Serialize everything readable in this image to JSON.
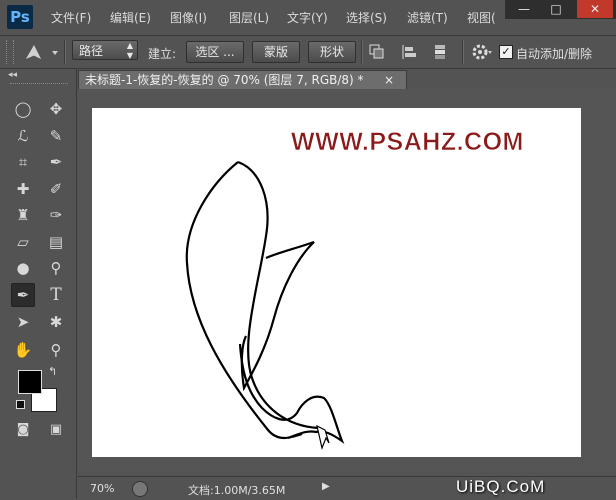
{
  "app": {
    "logo": "Ps"
  },
  "menu": [
    "文件(F)",
    "编辑(E)",
    "图像(I)",
    "图层(L)",
    "文字(Y)",
    "选择(S)",
    "滤镜(T)",
    "视图("
  ],
  "window_controls": {
    "minimize": "—",
    "restore": "□",
    "close": "✕"
  },
  "options_bar": {
    "mode_select": "路径",
    "make_label": "建立:",
    "selection_button": "选区 ...",
    "mask_button": "蒙版",
    "shape_button": "形状",
    "auto_add_delete_label": "自动添加/删除",
    "auto_add_delete_checked": true
  },
  "document": {
    "tab_title": "未标题-1-恢复的-恢复的 @ 70% (图层 7, RGB/8) *",
    "close": "×",
    "watermark_text": "WWW.PSAHZ.COM"
  },
  "status": {
    "zoom": "70%",
    "doc_info": "文档:1.00M/3.65M"
  },
  "corner_watermark": "UiBQ.CoM",
  "colors": {
    "foreground": "#000000",
    "background": "#ffffff",
    "watermark": "#8b1a1a"
  }
}
